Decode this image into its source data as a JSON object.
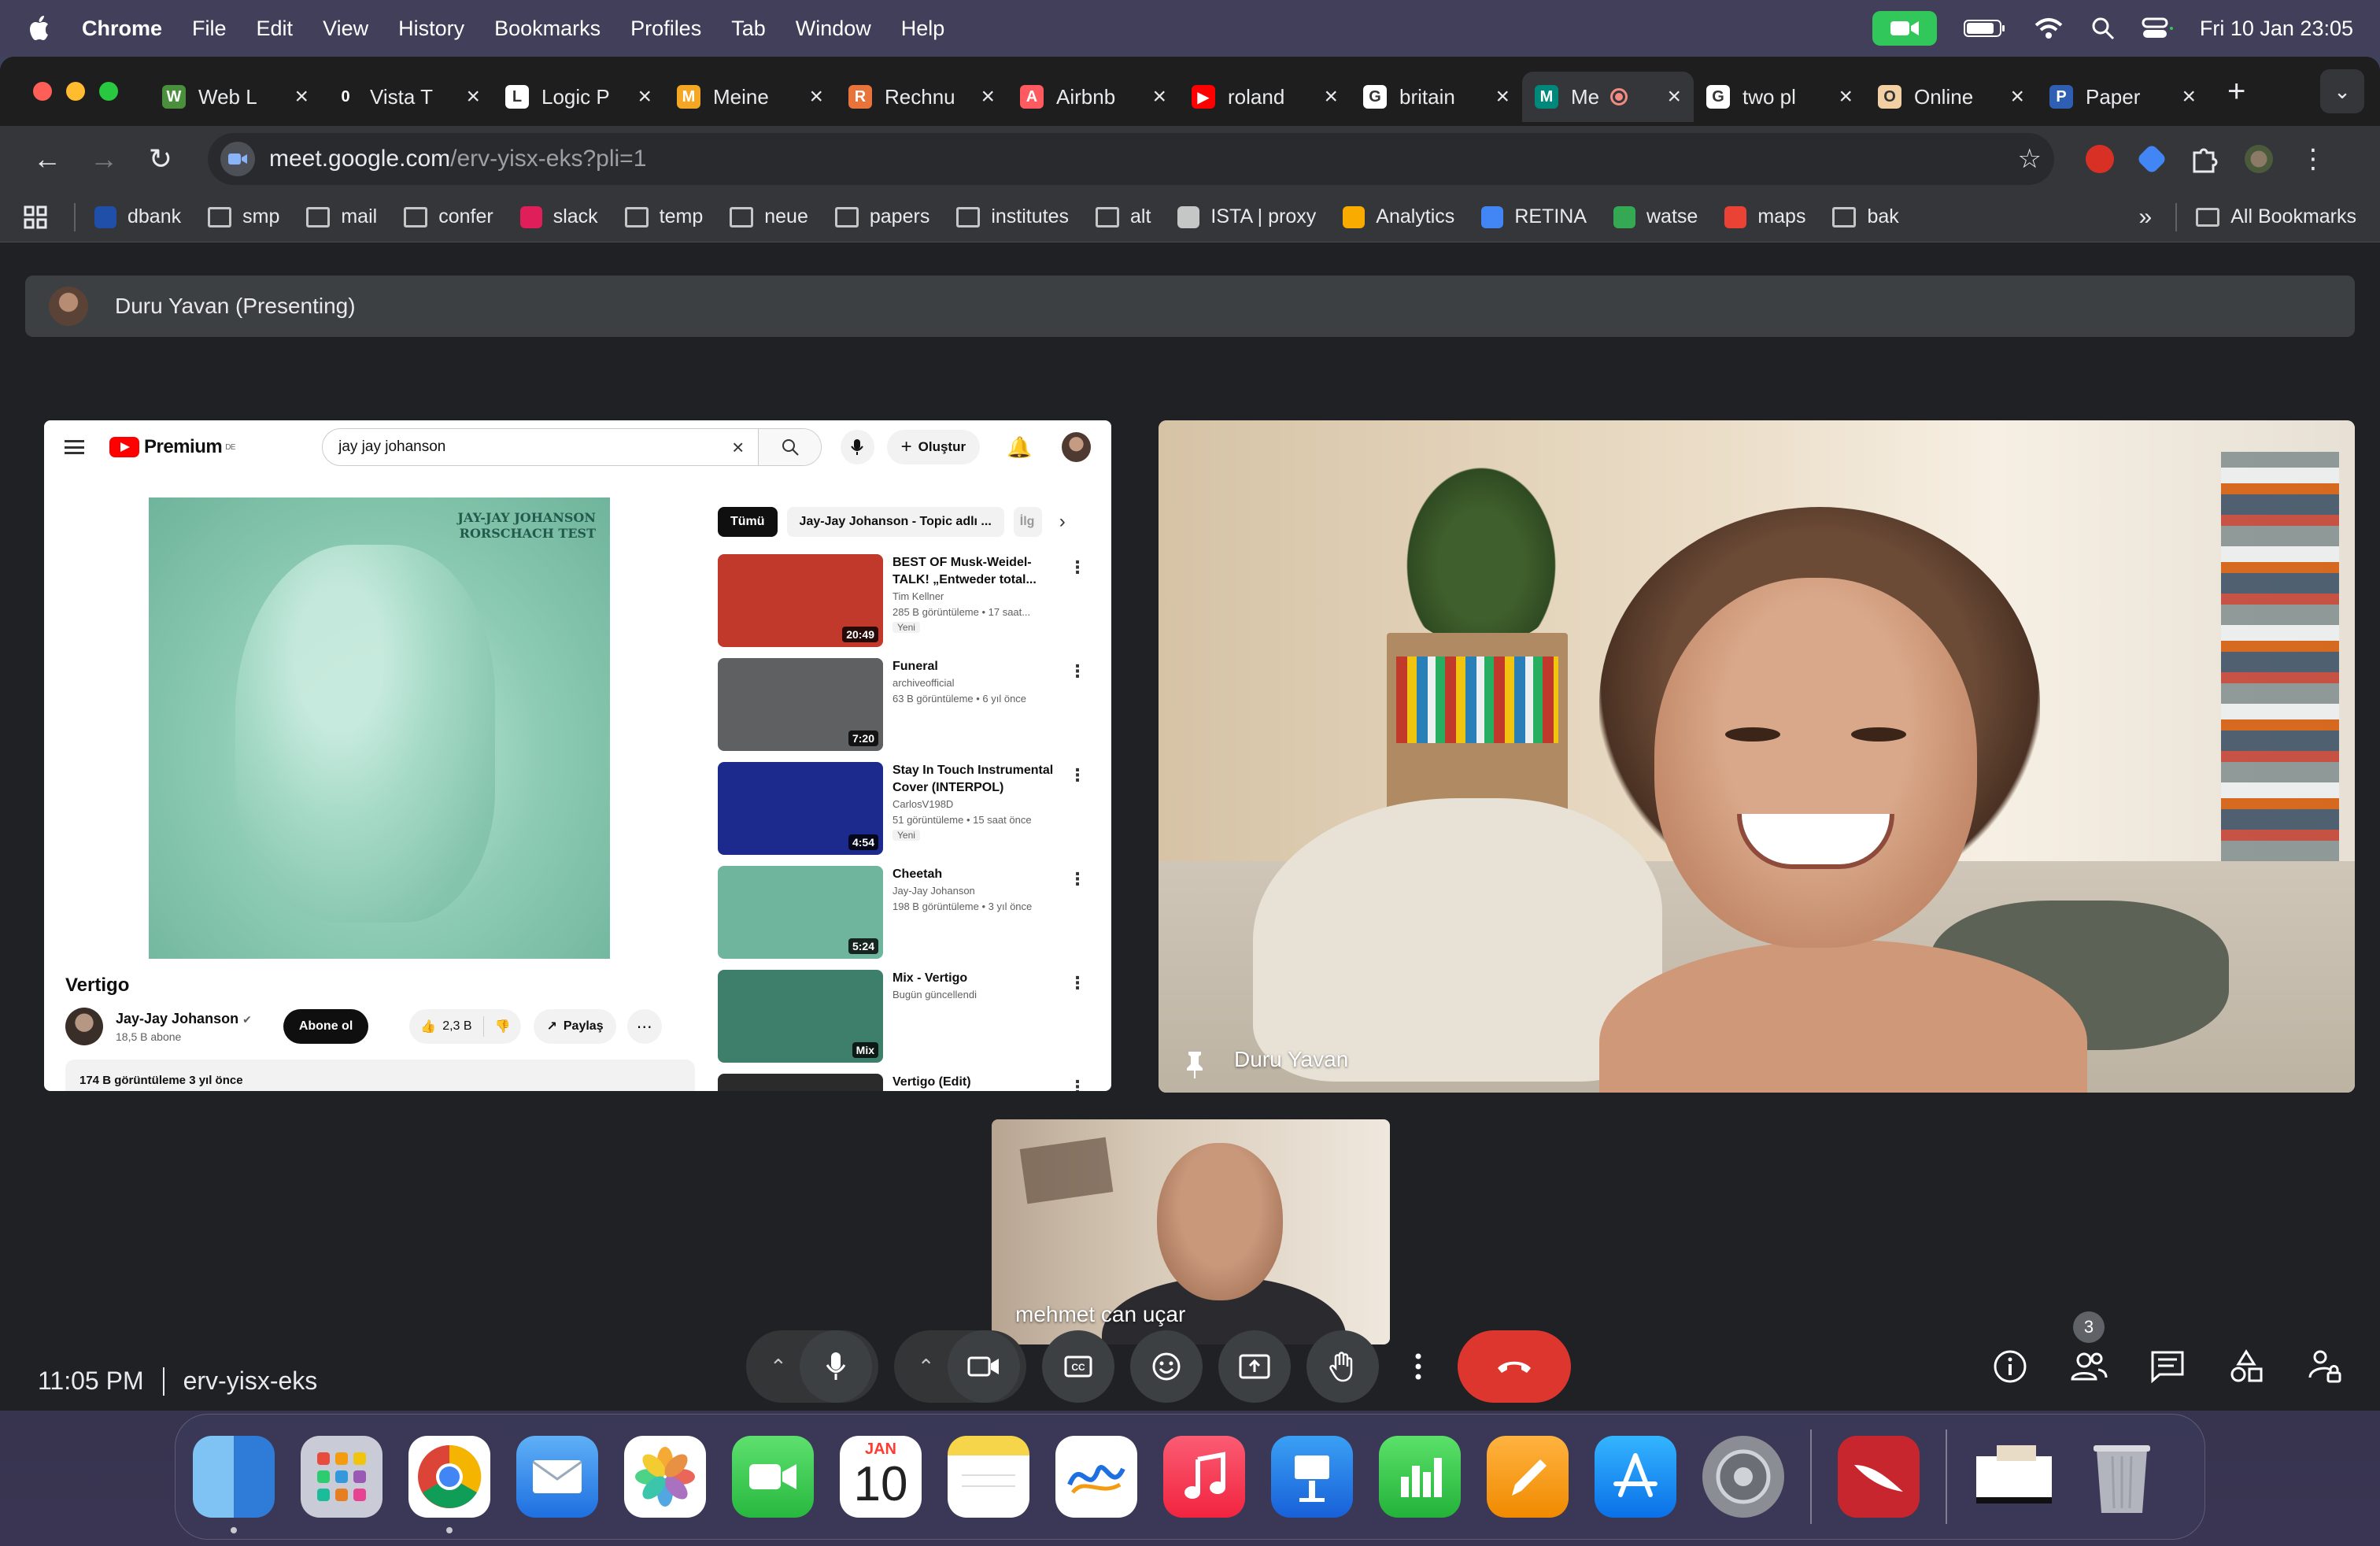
{
  "menubar": {
    "app_name": "Chrome",
    "items": [
      "File",
      "Edit",
      "View",
      "History",
      "Bookmarks",
      "Profiles",
      "Tab",
      "Window",
      "Help"
    ],
    "datetime": "Fri 10 Jan  23:05"
  },
  "tabs": [
    {
      "title": "Web L",
      "color": "#4a8f3c",
      "glyph": "W"
    },
    {
      "title": "Vista T",
      "color": "#1e1e1e",
      "glyph": "0"
    },
    {
      "title": "Logic P",
      "color": "#ffffff",
      "glyph": "L"
    },
    {
      "title": "Meine",
      "color": "#f5a623",
      "glyph": "M"
    },
    {
      "title": "Rechnu",
      "color": "#e8743b",
      "glyph": "R"
    },
    {
      "title": "Airbnb",
      "color": "#ff5a5f",
      "glyph": "A"
    },
    {
      "title": "roland",
      "color": "#ff0000",
      "glyph": "▶"
    },
    {
      "title": "britain",
      "color": "#ffffff",
      "glyph": "G"
    },
    {
      "title": "Me",
      "color": "#00897b",
      "glyph": "M",
      "active": true
    },
    {
      "title": "two pl",
      "color": "#ffffff",
      "glyph": "G"
    },
    {
      "title": "Online",
      "color": "#f2d0a4",
      "glyph": "O"
    },
    {
      "title": "Paper",
      "color": "#2f5fb3",
      "glyph": "P"
    }
  ],
  "address": {
    "host": "meet.google.com",
    "path": "/erv-yisx-eks?pli=1"
  },
  "bookmarks": [
    {
      "label": "dbank",
      "kind": "icon",
      "color": "#1f4fa8"
    },
    {
      "label": "smp",
      "kind": "folder"
    },
    {
      "label": "mail",
      "kind": "folder"
    },
    {
      "label": "confer",
      "kind": "folder"
    },
    {
      "label": "slack",
      "kind": "icon",
      "color": "#e01e5a"
    },
    {
      "label": "temp",
      "kind": "folder"
    },
    {
      "label": "neue",
      "kind": "folder"
    },
    {
      "label": "papers",
      "kind": "folder"
    },
    {
      "label": "institutes",
      "kind": "folder"
    },
    {
      "label": "alt",
      "kind": "folder"
    },
    {
      "label": "ISTA | proxy",
      "kind": "icon",
      "color": "#c4c7c5"
    },
    {
      "label": "Analytics",
      "kind": "icon",
      "color": "#f9ab00"
    },
    {
      "label": "RETINA",
      "kind": "icon",
      "color": "#4285f4"
    },
    {
      "label": "watse",
      "kind": "icon",
      "color": "#34a853"
    },
    {
      "label": "maps",
      "kind": "icon",
      "color": "#ea4335"
    },
    {
      "label": "bak",
      "kind": "folder"
    }
  ],
  "bookmarks_more": "»",
  "all_bookmarks": "All Bookmarks",
  "meet": {
    "presenter_banner": "Duru Yavan (Presenting)",
    "time": "11:05 PM",
    "meeting_code": "erv-yisx-eks",
    "participant_count": "3",
    "main_tile_name": "Duru Yavan",
    "self_tile_name": "mehmet can uçar"
  },
  "youtube": {
    "brand": "Premium",
    "region": "DE",
    "search_query": "jay jay johanson",
    "create_label": "Oluştur",
    "album_text_line1": "JAY-JAY JOHANSON",
    "album_text_line2": "RORSCHACH TEST",
    "video_title": "Vertigo",
    "channel_name": "Jay-Jay Johanson",
    "subscribers": "18,5 B abone",
    "subscribe_label": "Abone ol",
    "likes": "2,3 B",
    "share_label": "Paylaş",
    "views_line": "174 B görüntüleme  3 yıl önce",
    "chips": [
      "Tümü",
      "Jay-Jay Johanson - Topic adlı ...",
      "İlg"
    ],
    "recommendations": [
      {
        "title": "BEST OF Musk-Weidel-TALK! „Entweder total...",
        "channel": "Tim Kellner",
        "meta": "285 B görüntüleme  • 17 saat...",
        "duration": "20:49",
        "new": "Yeni",
        "thumb": "#c0392b"
      },
      {
        "title": "Funeral",
        "channel": "archiveofficial",
        "meta": "63 B görüntüleme  • 6 yıl önce",
        "duration": "7:20",
        "new": "",
        "thumb": "#5f6062"
      },
      {
        "title": "Stay In Touch Instrumental Cover (INTERPOL)",
        "channel": "CarlosV198D",
        "meta": "51 görüntüleme  • 15 saat önce",
        "duration": "4:54",
        "new": "Yeni",
        "thumb": "#1b2a8c"
      },
      {
        "title": "Cheetah",
        "channel": "Jay-Jay Johanson",
        "meta": "198 B görüntüleme  • 3 yıl önce",
        "duration": "5:24",
        "new": "",
        "thumb": "#6fb49c"
      },
      {
        "title": "Mix - Vertigo",
        "channel": "Bugün güncellendi",
        "meta": "",
        "duration": "Mix",
        "new": "",
        "thumb": "#3e7f6b"
      },
      {
        "title": "Vertigo (Edit)",
        "channel": "",
        "meta": "",
        "duration": "",
        "new": "",
        "thumb": "#2b2b2b"
      }
    ]
  },
  "dock": {
    "calendar_month": "JAN",
    "calendar_day": "10"
  }
}
